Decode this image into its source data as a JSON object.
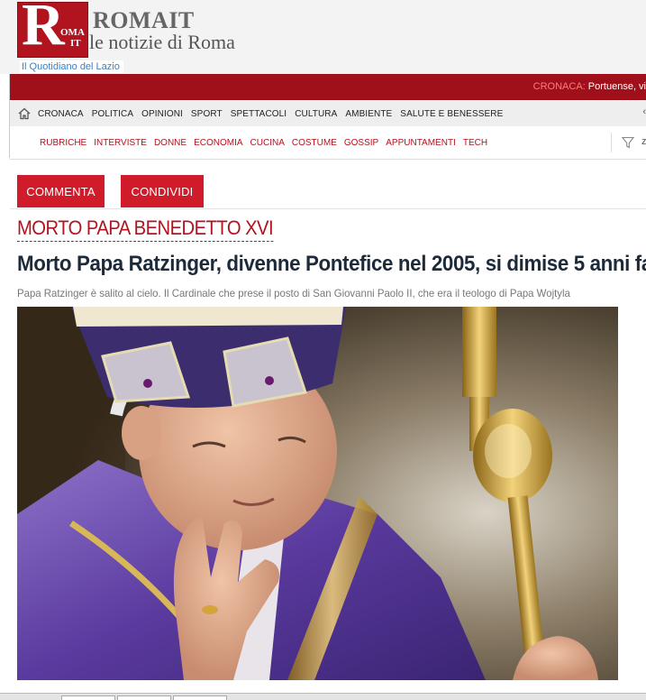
{
  "brand": {
    "logo_r": "R",
    "logo_roma": "OMA",
    "logo_it": "IT",
    "name": "ROMAIT",
    "tagline": "le notizie di Roma",
    "quotidiano": "Il Quotidiano del Lazio"
  },
  "ticker": {
    "label": "CRONACA:",
    "text": "Portuense, vi"
  },
  "colors": {
    "brand_red": "#a0101b",
    "button_red": "#d01b2a",
    "headline": "#1d2a3a"
  },
  "main_nav": [
    "CRONACA",
    "POLITICA",
    "OPINIONI",
    "SPORT",
    "SPETTACOLI",
    "CULTURA",
    "AMBIENTE",
    "SALUTE E BENESSERE"
  ],
  "sub_nav": [
    "RUBRICHE",
    "INTERVISTE",
    "DONNE",
    "ECONOMIA",
    "CUCINA",
    "COSTUME",
    "GOSSIP",
    "APPUNTAMENTI",
    "TECH"
  ],
  "filter_edge": "z",
  "actions": {
    "commenta": "COMMENTA",
    "condividi": "CONDIVIDI"
  },
  "article": {
    "kicker": "MORTO PAPA BENEDETTO XVI",
    "headline": "Morto Papa Ratzinger, divenne Pontefice nel 2005, si dimise 5 anni fa",
    "subtitle": "Papa Ratzinger è salito al cielo.  Il Cardinale che prese il posto di San Giovanni Paolo II, che era il teologo di Papa Wojtyla"
  }
}
